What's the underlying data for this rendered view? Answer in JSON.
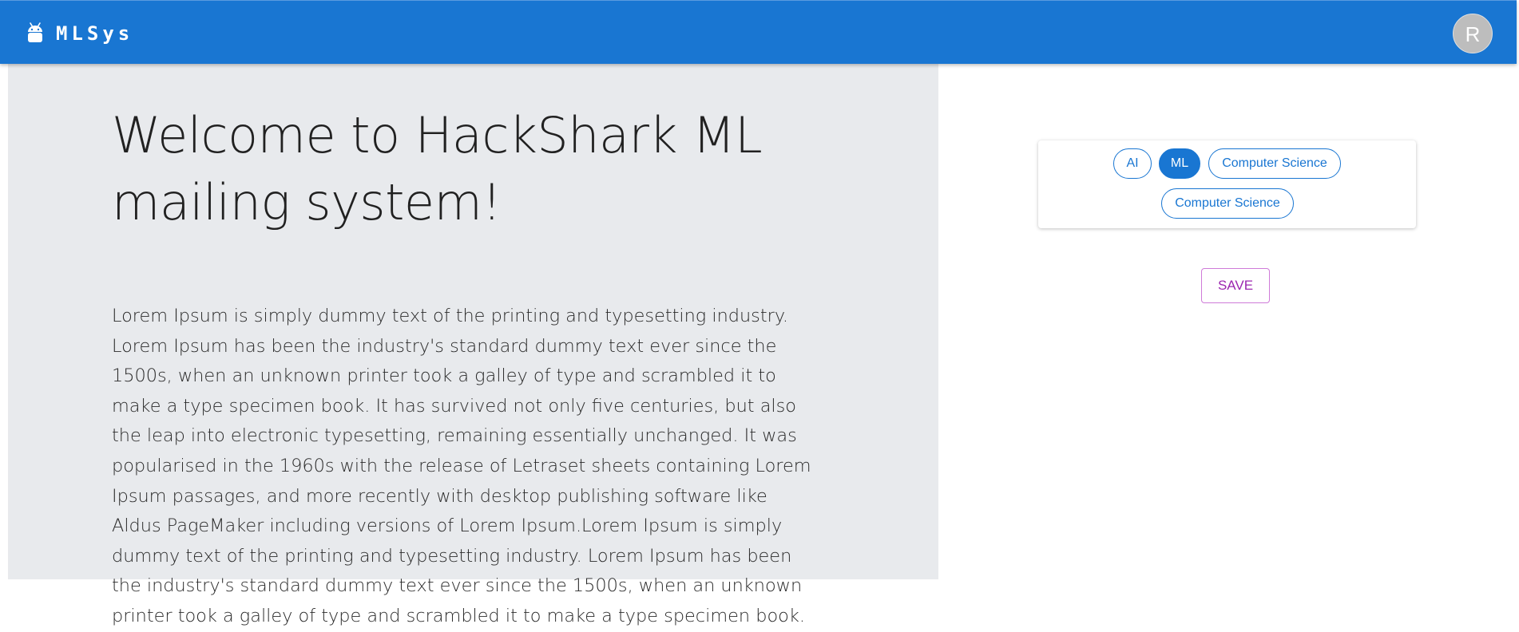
{
  "appbar": {
    "brand": "MLSys",
    "avatar_initial": "R",
    "color": "#1976d2"
  },
  "main": {
    "title": "Welcome to HackShark ML mailing system!",
    "body": "Lorem Ipsum is simply dummy text of the printing and typesetting industry. Lorem Ipsum has been the industry's standard dummy text ever since the 1500s, when an unknown printer took a galley of type and scrambled it to make a type specimen book. It has survived not only five centuries, but also the leap into electronic typesetting, remaining essentially unchanged. It was popularised in the 1960s with the release of Letraset sheets containing Lorem Ipsum passages, and more recently with desktop publishing software like Aldus PageMaker including versions of Lorem Ipsum.Lorem Ipsum is simply dummy text of the printing and typesetting industry. Lorem Ipsum has been the industry's standard dummy text ever since the 1500s, when an unknown printer took a galley of type and scrambled it to make a type specimen book."
  },
  "chips": [
    {
      "label": "AI",
      "selected": false
    },
    {
      "label": "ML",
      "selected": true
    },
    {
      "label": "Computer Science",
      "selected": false
    },
    {
      "label": "Computer Science",
      "selected": false
    }
  ],
  "save_label": "SAVE",
  "icons": {
    "logo": "android-icon"
  }
}
